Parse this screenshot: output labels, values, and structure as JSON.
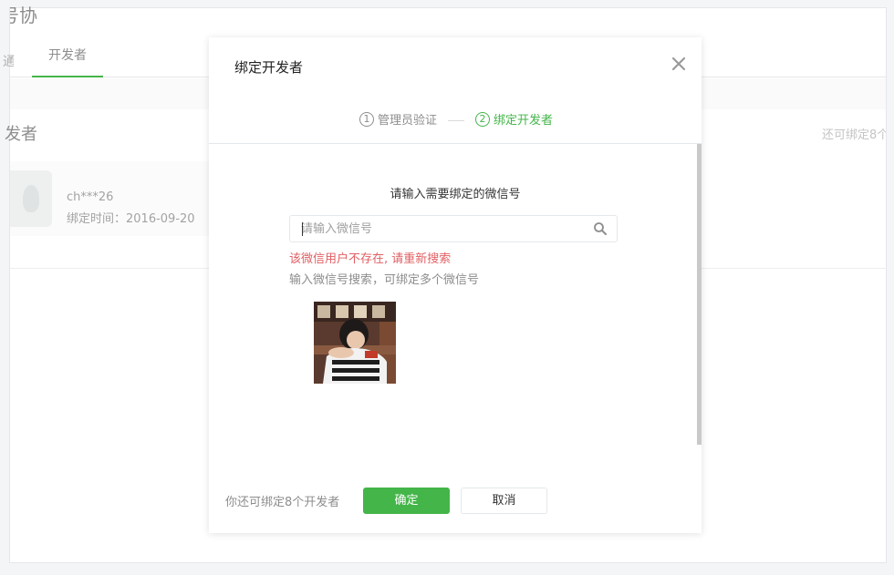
{
  "background": {
    "title": "号协",
    "tab_cut": "通",
    "tab_active": "开发者",
    "section_title": "发者",
    "remaining_hint": "还可绑定8个",
    "developer": {
      "name": "ch***26",
      "bind_time": "绑定时间：2016-09-20"
    }
  },
  "dialog": {
    "title": "绑定开发者",
    "close_icon": "close-icon",
    "steps": [
      {
        "num": "1",
        "label": "管理员验证"
      },
      {
        "num": "2",
        "label": "绑定开发者"
      }
    ],
    "prompt": "请输入需要绑定的微信号",
    "search": {
      "value": "",
      "placeholder": "请输入微信号",
      "icon": "search-icon"
    },
    "error_text": "该微信用户不存在, 请重新搜索",
    "tip_text": "输入微信号搜索，可绑定多个微信号",
    "footer_note": "你还可绑定8个开发者",
    "confirm_label": "确定",
    "cancel_label": "取消"
  },
  "colors": {
    "accent": "#44b549",
    "error": "#e15f63"
  }
}
